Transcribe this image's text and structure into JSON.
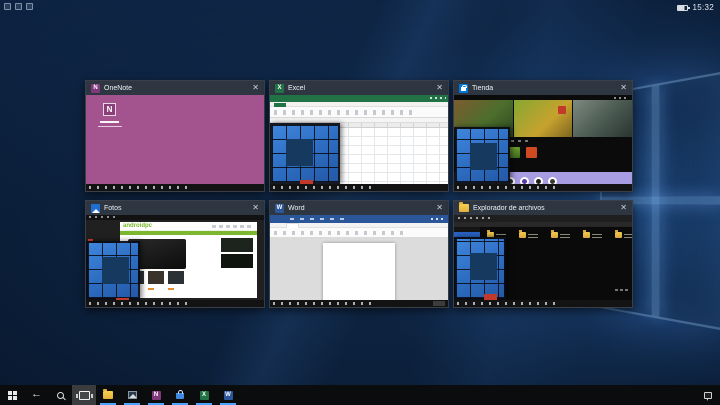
{
  "status_bar": {
    "clock": "15:32"
  },
  "task_view": {
    "close_glyph": "✕",
    "windows": [
      {
        "app": "onenote",
        "title": "OneNote",
        "icon_letter": "N"
      },
      {
        "app": "excel",
        "title": "Excel",
        "icon_letter": "X"
      },
      {
        "app": "store",
        "title": "Tienda"
      },
      {
        "app": "photos",
        "title": "Fotos"
      },
      {
        "app": "word",
        "title": "Word",
        "icon_letter": "W"
      },
      {
        "app": "file-explorer",
        "title": "Explorador de archivos"
      }
    ]
  },
  "thumbnail_content": {
    "onenote_splash_letter": "N",
    "photos_webpage_brand": "androidpc"
  },
  "taskbar": {
    "active_button": "task-view",
    "letters": {
      "onenote": "N",
      "excel": "X",
      "word": "W"
    },
    "underline_color": "#4aa3ff"
  },
  "colors": {
    "accent_blue": "#0078d7",
    "onenote_purple": "#a3538d",
    "excel_green": "#217346",
    "word_blue": "#2b579a",
    "store_band_lavender": "#a89ce2",
    "folder_yellow": "#efc84e",
    "thumbnail_titlebar": "#2e3742",
    "taskbar_black": "#0b0c0e"
  }
}
